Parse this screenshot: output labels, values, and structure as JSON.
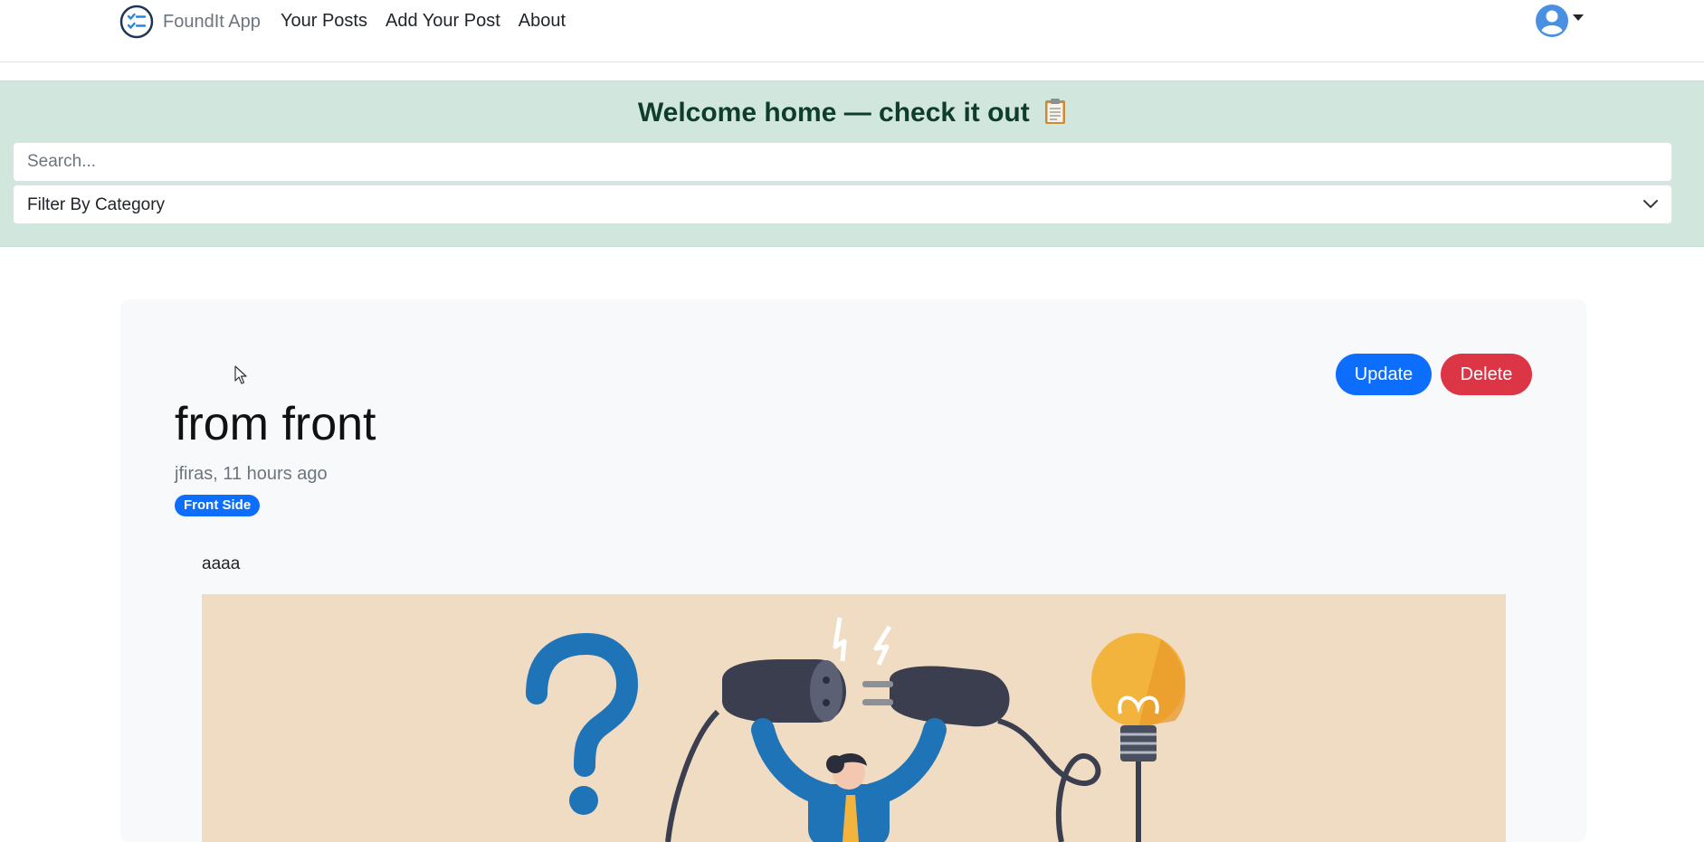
{
  "navbar": {
    "brand": "FoundIt App",
    "links": [
      "Your Posts",
      "Add Your Post",
      "About"
    ]
  },
  "welcome": {
    "title": "Welcome home — check it out",
    "search_placeholder": "Search...",
    "category_label": "Filter By Category"
  },
  "post": {
    "title": "from front",
    "meta": "jfiras, 11 hours ago",
    "category": "Front Side",
    "body": "aaaa",
    "update_label": "Update",
    "delete_label": "Delete"
  },
  "colors": {
    "primary": "#0d6efd",
    "danger": "#dc3545",
    "welcome_bg": "#d1e7dd",
    "card_bg": "#f8f9fa",
    "image_bg": "#f0dbc3"
  },
  "icons": [
    "checklist-logo-icon",
    "user-avatar-icon",
    "clipboard-icon",
    "chevron-down-icon",
    "mouse-cursor-icon"
  ]
}
